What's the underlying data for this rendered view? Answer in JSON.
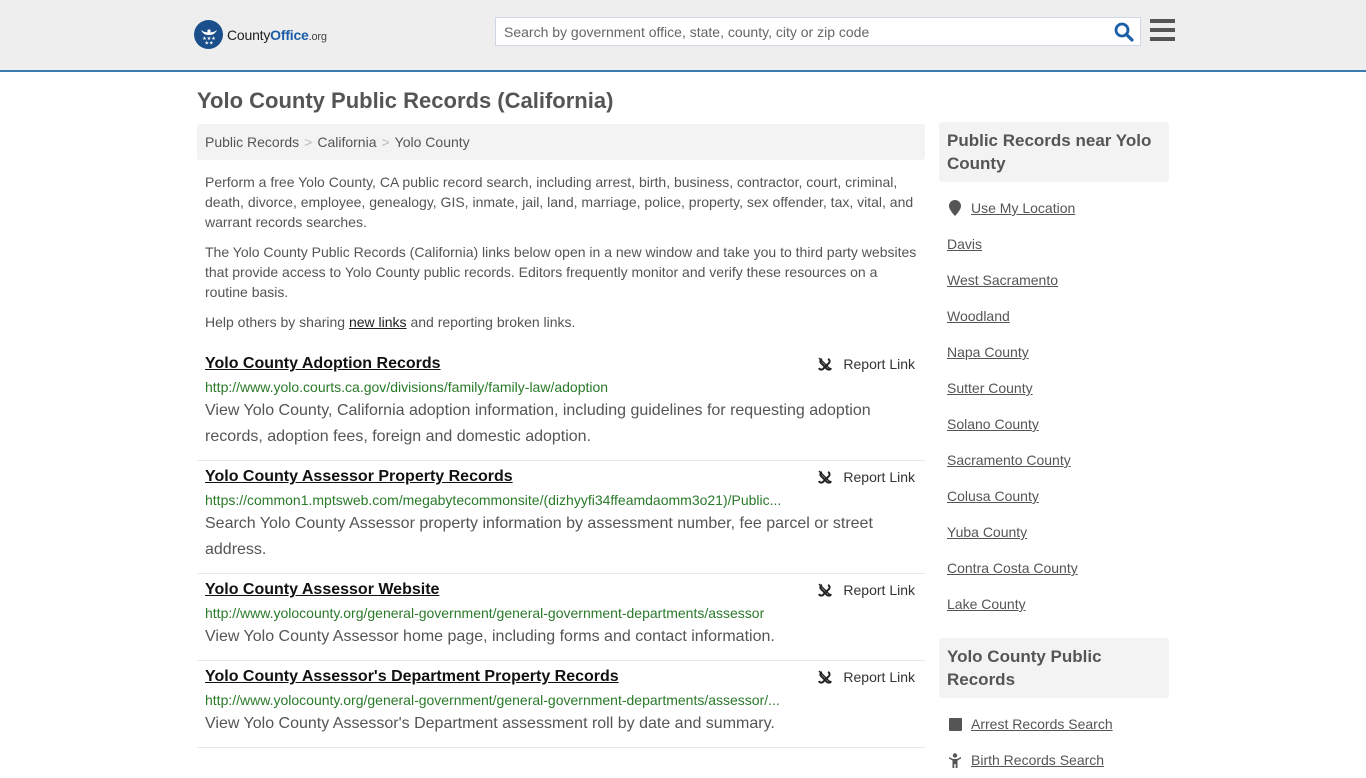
{
  "header": {
    "logo": {
      "name_part1": "County",
      "name_part2": "Office",
      "name_part3": ".org"
    },
    "search": {
      "placeholder": "Search by government office, state, county, city or zip code",
      "value": ""
    },
    "colors": {
      "accent": "#3a7cad",
      "brand": "#1b4f8c",
      "url_green": "#2a7a2a"
    }
  },
  "page": {
    "title": "Yolo County Public Records (California)",
    "breadcrumb": [
      "Public Records",
      "California",
      "Yolo County"
    ],
    "intro": {
      "p1": "Perform a free Yolo County, CA public record search, including arrest, birth, business, contractor, court, criminal, death, divorce, employee, genealogy, GIS, inmate, jail, land, marriage, police, property, sex offender, tax, vital, and warrant records searches.",
      "p2": "The Yolo County Public Records (California) links below open in a new window and take you to third party websites that provide access to Yolo County public records. Editors frequently monitor and verify these resources on a routine basis.",
      "p3_before": "Help others by sharing ",
      "p3_link": "new links",
      "p3_after": " and reporting broken links."
    },
    "report_label": "Report Link",
    "records": [
      {
        "title": "Yolo County Adoption Records",
        "url": "http://www.yolo.courts.ca.gov/divisions/family/family-law/adoption",
        "description": "View Yolo County, California adoption information, including guidelines for requesting adoption records, adoption fees, foreign and domestic adoption."
      },
      {
        "title": "Yolo County Assessor Property Records",
        "url": "https://common1.mptsweb.com/megabytecommonsite/(dizhyyfi34ffeamdaomm3o21)/Public...",
        "description": "Search Yolo County Assessor property information by assessment number, fee parcel or street address."
      },
      {
        "title": "Yolo County Assessor Website",
        "url": "http://www.yolocounty.org/general-government/general-government-departments/assessor",
        "description": "View Yolo County Assessor home page, including forms and contact information."
      },
      {
        "title": "Yolo County Assessor's Department Property Records",
        "url": "http://www.yolocounty.org/general-government/general-government-departments/assessor/...",
        "description": "View Yolo County Assessor's Department assessment roll by date and summary."
      }
    ]
  },
  "sidebar": {
    "nearby": {
      "heading": "Public Records near Yolo County",
      "use_location": "Use My Location",
      "items": [
        "Davis",
        "West Sacramento",
        "Woodland",
        "Napa County",
        "Sutter County",
        "Solano County",
        "Sacramento County",
        "Colusa County",
        "Yuba County",
        "Contra Costa County",
        "Lake County"
      ]
    },
    "county_records": {
      "heading": "Yolo County Public Records",
      "items": [
        {
          "label": "Arrest Records Search",
          "icon": "square-icon"
        },
        {
          "label": "Birth Records Search",
          "icon": "child-icon"
        }
      ]
    }
  }
}
